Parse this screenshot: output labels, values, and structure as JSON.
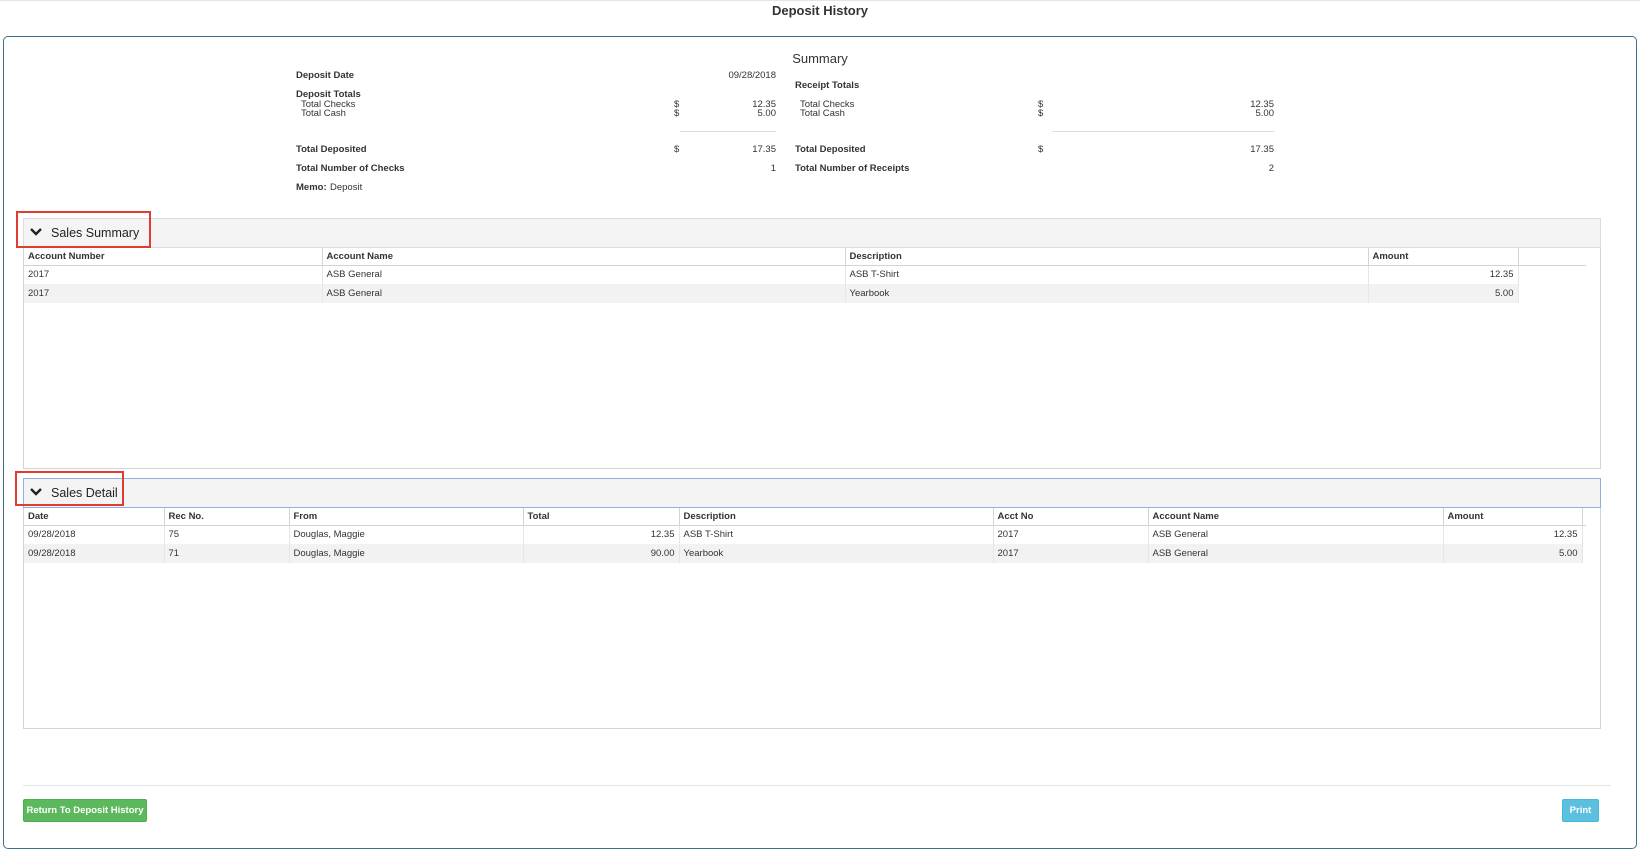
{
  "page": {
    "title": "Deposit History"
  },
  "summary": {
    "title": "Summary",
    "deposit_date_label": "Deposit Date",
    "deposit_date": "09/28/2018",
    "deposit_totals_label": "Deposit Totals",
    "total_checks_label": "Total Checks",
    "total_cash_label": "Total Cash",
    "dollar": "$",
    "deposit_checks": "12.35",
    "deposit_cash": "5.00",
    "total_deposited_label": "Total Deposited",
    "total_deposited": "17.35",
    "num_checks_label": "Total Number of Checks",
    "num_checks": "1",
    "memo_label": "Memo:",
    "memo": "Deposit",
    "receipt_totals_label": "Receipt Totals",
    "receipt_checks": "12.35",
    "receipt_cash": "5.00",
    "receipt_total_deposited": "17.35",
    "num_receipts_label": "Total Number of Receipts",
    "num_receipts": "2"
  },
  "sales_summary": {
    "label": "Sales Summary",
    "columns": [
      "Account Number",
      "Account Name",
      "Description",
      "Amount"
    ],
    "rows": [
      [
        "2017",
        "ASB General",
        "ASB T-Shirt",
        "12.35"
      ],
      [
        "2017",
        "ASB General",
        "Yearbook",
        "5.00"
      ]
    ]
  },
  "sales_detail": {
    "label": "Sales Detail",
    "columns": [
      "Date",
      "Rec No.",
      "From",
      "Total",
      "Description",
      "Acct No",
      "Account Name",
      "Amount"
    ],
    "rows": [
      [
        "09/28/2018",
        "75",
        "Douglas, Maggie",
        "12.35",
        "ASB T-Shirt",
        "2017",
        "ASB General",
        "12.35"
      ],
      [
        "09/28/2018",
        "71",
        "Douglas, Maggie",
        "90.00",
        "Yearbook",
        "2017",
        "ASB General",
        "5.00"
      ]
    ]
  },
  "buttons": {
    "return_label": "Return To Deposit History",
    "print_label": "Print",
    "return_color": "#5cb85c",
    "print_color": "#5bc0de"
  },
  "icons": {
    "collapse": "chevron-down-icon"
  },
  "accent": {
    "highlight_box": "#e03c31"
  }
}
